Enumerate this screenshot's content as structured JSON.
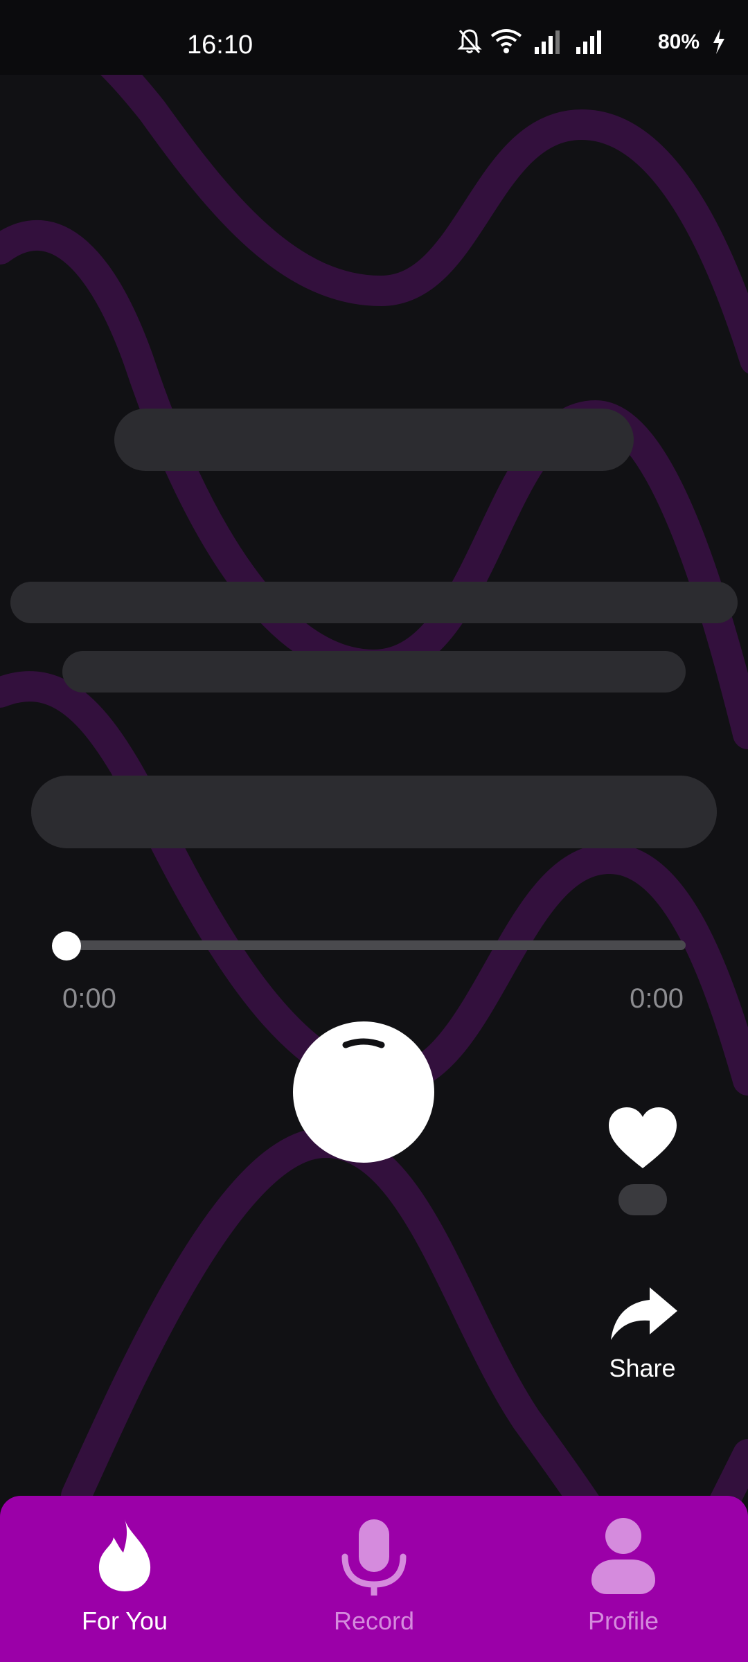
{
  "status_bar": {
    "time": "16:10",
    "battery": "80%",
    "icons": [
      "bell-muted-icon",
      "wifi-icon",
      "signal-icon",
      "signal-icon",
      "charging-icon"
    ]
  },
  "player": {
    "current_time": "0:00",
    "total_time": "0:00",
    "progress": 0
  },
  "actions": {
    "like_icon": "heart-icon",
    "share_label": "Share",
    "share_icon": "share-arrow-icon"
  },
  "nav": {
    "items": [
      {
        "label": "For You",
        "icon": "flame-icon",
        "active": true
      },
      {
        "label": "Record",
        "icon": "microphone-icon",
        "active": false
      },
      {
        "label": "Profile",
        "icon": "person-icon",
        "active": false
      }
    ]
  },
  "colors": {
    "background": "#111114",
    "accent": "#9b00a8",
    "nav_inactive": "#d58bdd",
    "wave": "#3a0f45",
    "skeleton": "#2c2c30"
  }
}
